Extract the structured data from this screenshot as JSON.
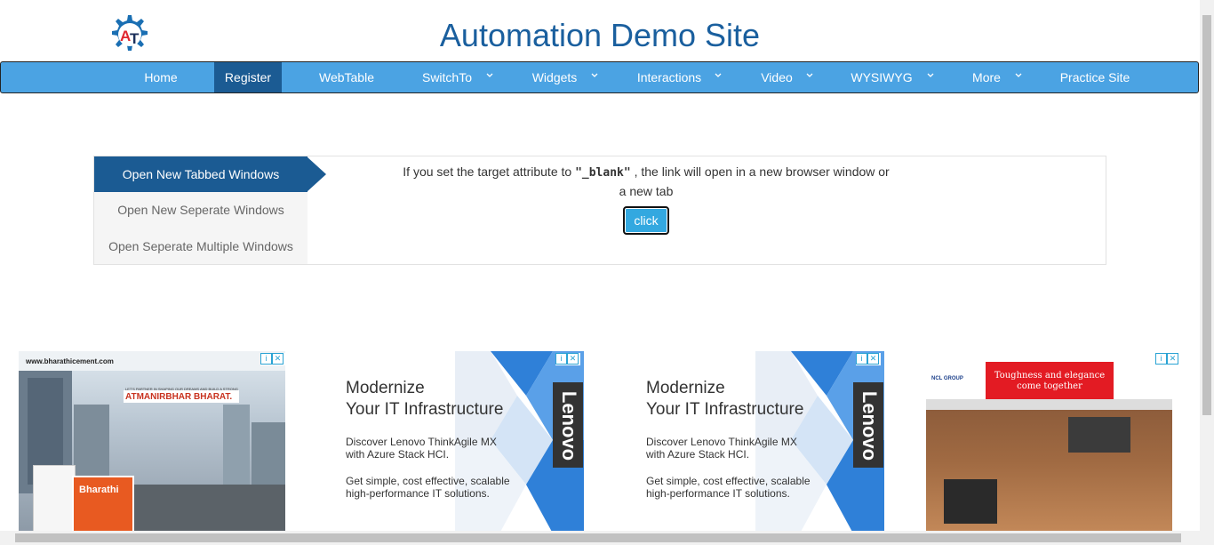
{
  "header": {
    "title": "Automation Demo Site",
    "logo_icon": "at-gear-logo",
    "logo_letters": "AT"
  },
  "nav": {
    "items": [
      {
        "label": "Home",
        "dropdown": false,
        "active": false
      },
      {
        "label": "Register",
        "dropdown": false,
        "active": true
      },
      {
        "label": "WebTable",
        "dropdown": false,
        "active": false
      },
      {
        "label": "SwitchTo",
        "dropdown": true,
        "active": false
      },
      {
        "label": "Widgets",
        "dropdown": true,
        "active": false
      },
      {
        "label": "Interactions",
        "dropdown": true,
        "active": false
      },
      {
        "label": "Video",
        "dropdown": true,
        "active": false
      },
      {
        "label": "WYSIWYG",
        "dropdown": true,
        "active": false
      },
      {
        "label": "More",
        "dropdown": true,
        "active": false
      },
      {
        "label": "Practice Site",
        "dropdown": false,
        "active": false
      }
    ]
  },
  "windows_panel": {
    "tabs": [
      {
        "label": "Open New Tabbed Windows",
        "active": true
      },
      {
        "label": "Open New Seperate Windows",
        "active": false
      },
      {
        "label": "Open Seperate Multiple Windows",
        "active": false
      }
    ],
    "description_before": "If you set the target attribute to ",
    "description_code": "\"_blank\"",
    "description_after": " , the link will open in a new browser window or a new tab",
    "button_label": "click"
  },
  "ads": {
    "cement": {
      "url": "www.bharathicement.com",
      "slogan": "ATMANIRBHAR BHARAT.",
      "tagline": "LET'S PARTNER IN SHAPING OUR DREAMS AND BUILD A STRONG",
      "brand": "Bharathi"
    },
    "lenovo": {
      "heading_line1": "Modernize",
      "heading_line2": "Your IT Infrastructure",
      "p1_line1": "Discover Lenovo ThinkAgile MX",
      "p1_line2": "with Azure Stack HCI.",
      "p2_line1": "Get simple, cost effective, scalable",
      "p2_line2": "high-performance IT solutions.",
      "brand": "Lenovo"
    },
    "ncl": {
      "tagline": "Toughness and elegance come together",
      "logo": "NCL GROUP"
    },
    "adchoice_info": "i",
    "adchoice_close": "✕"
  },
  "colors": {
    "title": "#1a5f9e",
    "nav_bg": "#4ba3e3",
    "nav_active": "#1b5b93",
    "button_bg": "#33a8e0"
  }
}
